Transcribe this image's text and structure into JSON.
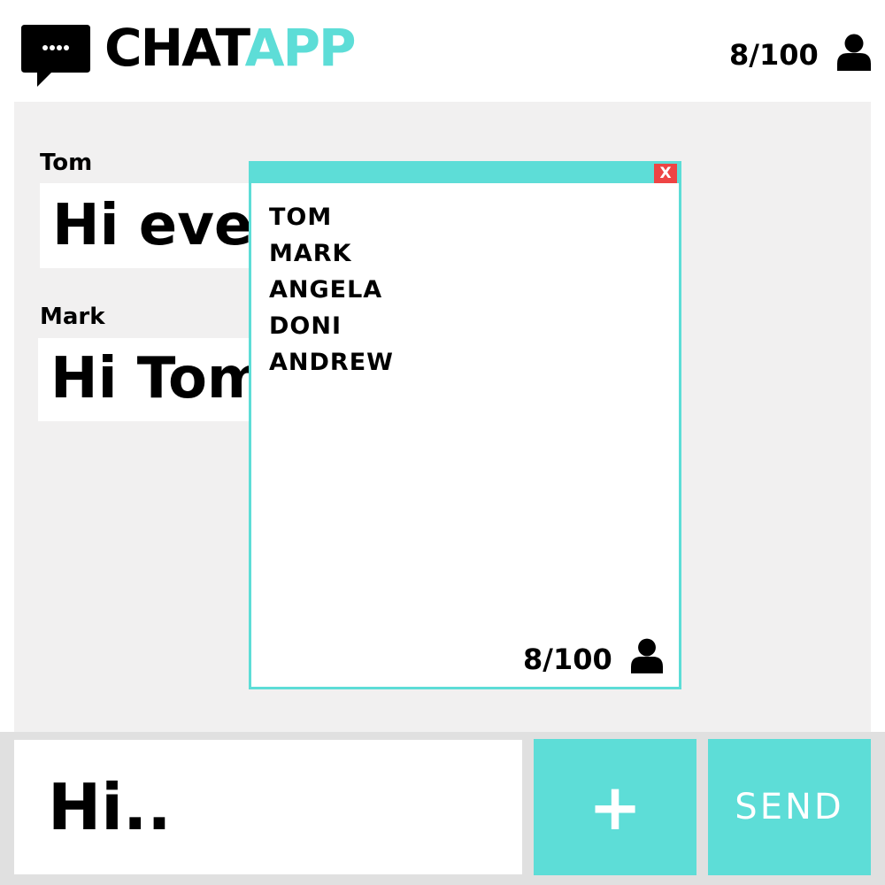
{
  "app": {
    "brand_part1": "CHAT",
    "brand_part2": "APP",
    "logo_icon": "chat-bubble-icon",
    "user_count": "8/100",
    "user_icon": "user-icon"
  },
  "messages": [
    {
      "sender": "Tom",
      "text": "Hi eve"
    },
    {
      "sender": "Mark",
      "text": "Hi Tom"
    }
  ],
  "members_popup": {
    "close_label": "X",
    "members": [
      "TOM",
      "MARK",
      "ANGELA",
      "DONI",
      "ANDREW"
    ],
    "user_count": "8/100",
    "user_icon": "user-icon"
  },
  "composer": {
    "value": "Hi..",
    "add_label": "+",
    "send_label": "SEND"
  },
  "colors": {
    "accent": "#5dddd7",
    "chat_background": "#f1f0f0",
    "footer_background": "#e0e0e0",
    "close_button": "#ee4444",
    "text": "#000000"
  }
}
